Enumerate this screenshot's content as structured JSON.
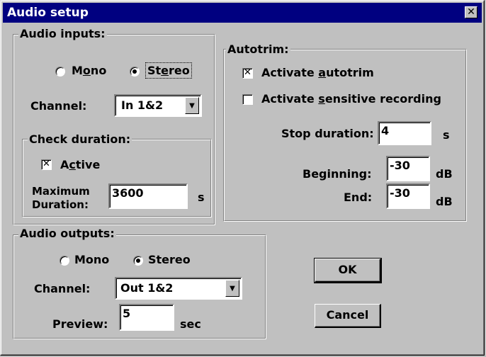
{
  "window": {
    "title": "Audio setup",
    "close_glyph": "✕"
  },
  "audio_inputs": {
    "label": "Audio inputs:",
    "mono_label": "Mono",
    "stereo_label": "Stereo",
    "selected_mode": "Stereo",
    "channel_label": "Channel:",
    "channel_value": "In 1&2",
    "check_duration": {
      "label": "Check duration:",
      "active_label": "Active",
      "active_checked": true,
      "max_label_line1": "Maximum",
      "max_label_line2": "Duration:",
      "max_value": "3600",
      "unit": "s"
    }
  },
  "autotrim": {
    "label": "Autotrim:",
    "activate_label": "Activate autotrim",
    "activate_checked": true,
    "sensitive_label": "Activate sensitive recording",
    "sensitive_checked": false,
    "stop_label": "Stop duration:",
    "stop_value": "4",
    "stop_unit": "s",
    "beginning_label": "Beginning:",
    "beginning_value": "-30",
    "beginning_unit": "dB",
    "end_label": "End:",
    "end_value": "-30",
    "end_unit": "dB"
  },
  "audio_outputs": {
    "label": "Audio outputs:",
    "mono_label": "Mono",
    "stereo_label": "Stereo",
    "selected_mode": "Stereo",
    "channel_label": "Channel:",
    "channel_value": "Out 1&2",
    "preview_label": "Preview:",
    "preview_value": "5",
    "preview_unit": "sec"
  },
  "buttons": {
    "ok": "OK",
    "cancel": "Cancel"
  },
  "icons": {
    "check": "check-x-icon",
    "dropdown": "dropdown-arrow-icon",
    "close": "close-icon"
  }
}
